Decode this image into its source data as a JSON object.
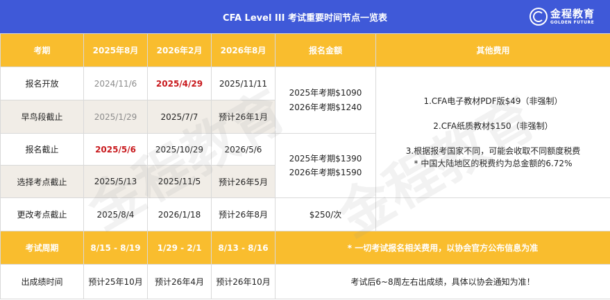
{
  "title": "CFA Level III 考试重要时间节点一览表",
  "logo": {
    "cn": "金程教育",
    "en": "GOLDEN FUTURE"
  },
  "watermark": "金程教育",
  "header": {
    "term": "考期",
    "col1": "2025年8月",
    "col2": "2026年2月",
    "col3": "2026年8月",
    "fee": "报名金额",
    "other": "其他费用"
  },
  "rows": [
    {
      "label": "报名开放",
      "c1": "2024/11/6",
      "c2": "2025/4/29",
      "c3": "2025/11/11"
    },
    {
      "label": "早鸟段截止",
      "c1": "2025/1/29",
      "c2": "2025/7/7",
      "c3": "预计26年1月"
    },
    {
      "label": "报名截止",
      "c1": "2025/5/6",
      "c2": "2025/10/29",
      "c3": "2026/5/6"
    },
    {
      "label": "选择考点截止",
      "c1": "2025/5/13",
      "c2": "2025/11/5",
      "c3": "预计26年5月"
    },
    {
      "label": "更改考点截止",
      "c1": "2025/8/4",
      "c2": "2026/1/18",
      "c3": "预计26年8月"
    }
  ],
  "fees": {
    "early_2025": "2025年考期$1090",
    "early_2026": "2026年考期$1240",
    "std_2025": "2025年考期$1390",
    "std_2026": "2026年考期$1590",
    "change": "$250/次"
  },
  "other_fees": [
    "1.CFA电子教材PDF版$49（非强制）",
    "2.CFA纸质教材$150（非强制）",
    "3.根据报考国家不同，可能会收取不同额度税费",
    "* 中国大陆地区的税费约为总金额的6.72%"
  ],
  "cycle": {
    "label": "考试周期",
    "c1": "8/15 - 8/19",
    "c2": "1/29 - 2/1",
    "c3": "8/13 - 8/16",
    "note": "* 一切考试报名相关费用，以协会官方公布信息为准"
  },
  "result": {
    "label": "出成绩时间",
    "c1": "预计25年10月",
    "c2": "预计26年4月",
    "c3": "预计26年10月",
    "note": "考试后6~8周左右出成绩，具体以协会通知为准！"
  },
  "colors": {
    "title_bg": "#3f59d8",
    "header_bg": "#f9bd2e",
    "shade_bg": "#f1ede7",
    "highlight_red": "#c8191d"
  }
}
